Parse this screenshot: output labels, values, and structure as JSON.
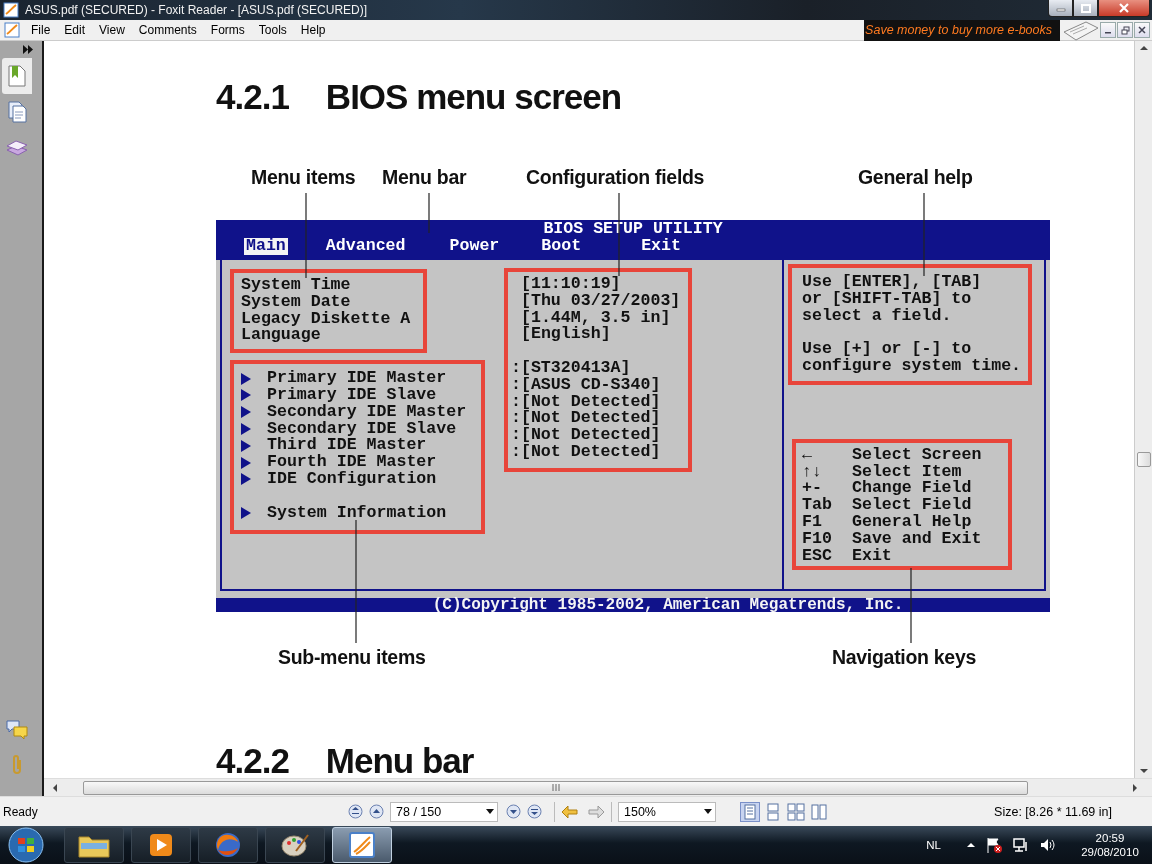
{
  "window": {
    "title": "ASUS.pdf (SECURED) - Foxit Reader - [ASUS.pdf (SECURED)]"
  },
  "menu": [
    "File",
    "Edit",
    "View",
    "Comments",
    "Forms",
    "Tools",
    "Help"
  ],
  "ad_banner": "Save money to buy more e-books",
  "sidebar": {
    "tabs": [
      {
        "kind": "bookmarks",
        "selected": true
      },
      {
        "kind": "pages",
        "selected": false
      },
      {
        "kind": "layers",
        "selected": false
      }
    ],
    "bottom_tabs": [
      {
        "kind": "comments"
      },
      {
        "kind": "attachments"
      }
    ]
  },
  "document": {
    "heading_1": {
      "number": "4.2.1",
      "title": "BIOS menu screen"
    },
    "callouts_top": [
      "Menu items",
      "Menu bar",
      "Configuration fields",
      "General help"
    ],
    "bios": {
      "title": "BIOS SETUP UTILITY",
      "tabs": [
        {
          "label": "Main",
          "selected": true
        },
        {
          "label": "Advanced",
          "selected": false
        },
        {
          "label": "Power",
          "selected": false
        },
        {
          "label": "Boot",
          "selected": false
        },
        {
          "label": "Exit",
          "selected": false
        }
      ],
      "settings": [
        "System Time",
        "System Date",
        "Legacy Diskette A",
        "Language"
      ],
      "setting_values": [
        "[11:10:19]",
        "[Thu 03/27/2003]",
        "[1.44M, 3.5 in]",
        "[English]"
      ],
      "submenu_groups": [
        [
          "Primary IDE Master",
          "Primary IDE Slave",
          "Secondary IDE Master",
          "Secondary IDE Slave",
          "Third IDE Master",
          "Fourth IDE Master",
          "IDE Configuration"
        ],
        [
          "System Information"
        ]
      ],
      "submenu_values": [
        ":[ST320413A]",
        ":[ASUS CD-S340]",
        ":[Not Detected]",
        ":[Not Detected]",
        ":[Not Detected]",
        ":[Not Detected]"
      ],
      "help": [
        "Use [ENTER], [TAB]\nor [SHIFT-TAB] to\nselect a field.",
        "Use [+] or [-] to\nconfigure system time."
      ],
      "keys": [
        {
          "key": "←",
          "action": "Select Screen"
        },
        {
          "key": "↑↓",
          "action": "Select Item"
        },
        {
          "key": "+-",
          "action": "Change Field"
        },
        {
          "key": "Tab",
          "action": "Select Field"
        },
        {
          "key": "F1",
          "action": "General Help"
        },
        {
          "key": "F10",
          "action": "Save and Exit"
        },
        {
          "key": "ESC",
          "action": "Exit"
        }
      ],
      "copyright": "(C)Copyright 1985-2002, American Megatrends, Inc."
    },
    "callouts_bottom": [
      "Sub-menu items",
      "Navigation keys"
    ],
    "heading_2": {
      "number": "4.2.2",
      "title": "Menu bar"
    }
  },
  "status_bar": {
    "text": "Ready",
    "page_field": "78 / 150",
    "zoom_field": "150%",
    "view_modes": [
      {
        "kind": "single",
        "selected": true
      },
      {
        "kind": "continuous",
        "selected": false
      },
      {
        "kind": "facing",
        "selected": false
      },
      {
        "kind": "continuous-facing",
        "selected": false
      }
    ],
    "page_size": "Size: [8.26 * 11.69 in]"
  },
  "taskbar": {
    "apps": [
      {
        "kind": "explorer",
        "selected": false
      },
      {
        "kind": "media",
        "selected": false
      },
      {
        "kind": "browser",
        "selected": false
      },
      {
        "kind": "paint",
        "selected": false
      },
      {
        "kind": "reader",
        "selected": true
      }
    ],
    "language": "NL",
    "time": "20:59",
    "date": "29/08/2010"
  }
}
